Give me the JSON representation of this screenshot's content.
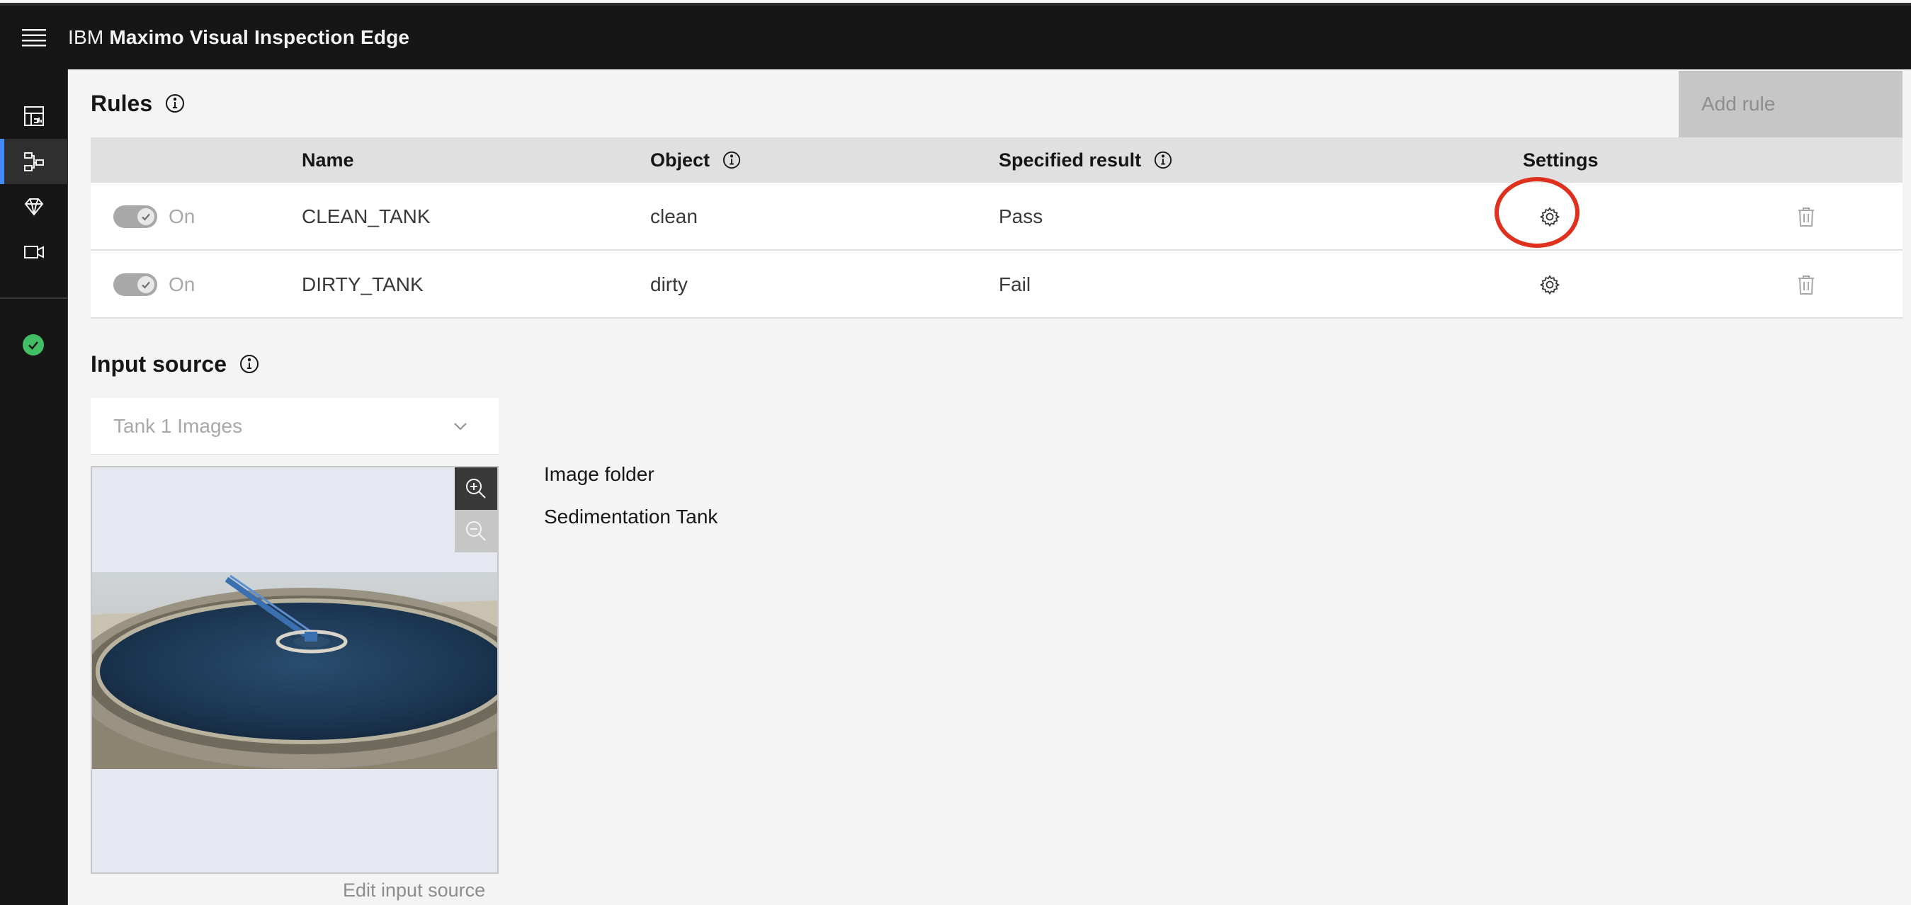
{
  "header": {
    "brand_prefix": "IBM",
    "product_name": "Maximo Visual Inspection Edge"
  },
  "sidenav": {
    "items": [
      {
        "id": "dashboard",
        "icon": "dashboard-icon"
      },
      {
        "id": "inspections",
        "icon": "inspection-flow-icon",
        "active": true
      },
      {
        "id": "models",
        "icon": "gem-icon"
      },
      {
        "id": "cameras",
        "icon": "video-camera-icon"
      }
    ],
    "status": {
      "icon": "checkmark-circle-icon",
      "color": "#42be65"
    }
  },
  "rules": {
    "title": "Rules",
    "add_button": "Add rule",
    "columns": {
      "name": "Name",
      "object": "Object",
      "result": "Specified result",
      "settings": "Settings"
    },
    "rows": [
      {
        "toggle_label": "On",
        "enabled": true,
        "name": "CLEAN_TANK",
        "object": "clean",
        "result": "Pass"
      },
      {
        "toggle_label": "On",
        "enabled": true,
        "name": "DIRTY_TANK",
        "object": "dirty",
        "result": "Fail"
      }
    ]
  },
  "input_source": {
    "title": "Input source",
    "selected": "Tank 1 Images",
    "type_label": "Image folder",
    "name_label": "Sedimentation Tank",
    "edit_link": "Edit input source"
  },
  "colors": {
    "accent": "#4589ff",
    "highlight_ring": "#e0301e",
    "header_bg": "#161616"
  }
}
